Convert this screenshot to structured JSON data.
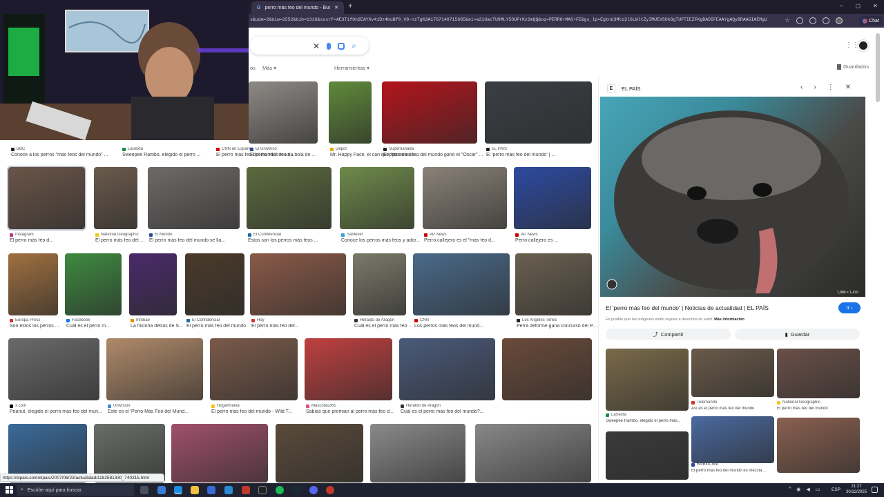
{
  "browser": {
    "active_tab_title": "perro más feo del mundo - Buscar",
    "new_tab_symbol": "+",
    "url": "s&udm=2&biw=2552&bih=1316&sxsrf=AE3TifOn2EAYXv41Dz4buBf0_V8-nzTg%3A1767140715605&ei=a21UacTU9MLY5OUPrKz2mQQ&oq=PERRO+MAS+FE&gs_lp=Egtnd3Mtd2l6LWltZyIMUEVSUk8gTUFTIEZFKgBADIFEAAYgAQyBRAAGIAEMgU",
    "chat_label": "Chat"
  },
  "search": {
    "filter_cut": "os",
    "more_label": "Más",
    "tools_label": "Herramientas",
    "saved_label": "Guardados"
  },
  "results": [
    {
      "source": "BBC",
      "title": "Conoce a los perros \"más feos del mundo\" ...",
      "color": "#8a7a6a",
      "fav": "#222"
    },
    {
      "source": "LaSexta",
      "title": "Sweepee Rambo, elegido el perro ...",
      "color": "#7a6b5c",
      "fav": "#1a8a3a"
    },
    {
      "source": "CNN en Español",
      "title": "El perro más feo del mundo\" es una bola de ...",
      "color": "#b0a79a",
      "fav": "#cc0000"
    },
    {
      "source": "El Universo",
      "title": "El perro 'más feo d...",
      "color": "#8e8a86",
      "fav": "#2a4b8d"
    },
    {
      "source": "Depor",
      "title": "Mr. Happy Face, el can que \"parece un ...",
      "color": "#5f8a3a",
      "fav": "#e6a800"
    },
    {
      "source": "Supernanada",
      "title": "El perro más feo del mundo ganó el \"Óscar\" ...",
      "color": "#b3141c",
      "fav": "#222"
    },
    {
      "source": "EL PAÍS",
      "title": "El 'perro más feo del mundo' | ...",
      "color": "#3a3f44",
      "fav": "#222"
    },
    {
      "source": "Instagram",
      "title": "El perro más feo d...",
      "color": "#6a5548",
      "fav": "#c13584"
    },
    {
      "source": "National Geographic",
      "title": "El perro más feo del mundo",
      "color": "#6b5a4c",
      "fav": "#f5c518"
    },
    {
      "source": "El Mundo",
      "title": "El perro más feo del mundo se lla...",
      "color": "#6e6a68",
      "fav": "#2a4b8d"
    },
    {
      "source": "El Confidencial",
      "title": "Estos son los perros más feos ...",
      "color": "#5c6a3e",
      "fav": "#1a6aa8"
    },
    {
      "source": "Sanlevel",
      "title": "Conoce los perros más feos y ador...",
      "color": "#6e8a4a",
      "fav": "#3aa1d8"
    },
    {
      "source": "AP News",
      "title": "Perro callejero es el \"más feo d...",
      "color": "#8a8278",
      "fav": "#cc0000"
    },
    {
      "source": "AP News",
      "title": "Perro callejero es ...",
      "color": "#2d4aa0",
      "fav": "#cc0000"
    },
    {
      "source": "Europa Press",
      "title": "Son estos los perros ...",
      "color": "#a07040",
      "fav": "#d0342c"
    },
    {
      "source": "Facebook",
      "title": "Cuál es el perro m...",
      "color": "#3e8a40",
      "fav": "#1877f2"
    },
    {
      "source": "Infobae",
      "title": "La historia detrás de S...",
      "color": "#4a2a6a",
      "fav": "#f08a00"
    },
    {
      "source": "El Confidencial",
      "title": "El perro más feo del mundo",
      "color": "#4a3a2a",
      "fav": "#1a6aa8"
    },
    {
      "source": "Hoy",
      "title": "El perro más feo del...",
      "color": "#8a5a48",
      "fav": "#d0342c"
    },
    {
      "source": "Heraldo de Aragón",
      "title": "Cuál es el perro más feo del mundo? | ...",
      "color": "#7a7a6a",
      "fav": "#333"
    },
    {
      "source": "CNN",
      "title": "Los perros más feos del mund...",
      "color": "#4a6a8a",
      "fav": "#cc0000"
    },
    {
      "source": "Los Angeles Times",
      "title": "Perra deforme gana concurso del Per...",
      "color": "#6a6050",
      "fav": "#222"
    },
    {
      "source": "x.com",
      "title": "Peanut, elegido el perro más feo del mun...",
      "color": "#6a6a6a",
      "fav": "#000"
    },
    {
      "source": "Univision",
      "title": "Este es el 'Perro Más Feo del Mund...",
      "color": "#b08a6a",
      "fav": "#3a8ad8"
    },
    {
      "source": "Hogarmania",
      "title": "El perro más feo del mundo - Wild T...",
      "color": "#7a5a4a",
      "fav": "#f5c518"
    },
    {
      "source": "Mascotas365",
      "title": "Sabías que premian al perro más feo d...",
      "color": "#c04040",
      "fav": "#e05080"
    },
    {
      "source": "Heraldo de Aragón",
      "title": "Cuál es el perro más feo del mundo?...",
      "color": "#4a5a7a",
      "fav": "#333"
    },
    {
      "source": "",
      "title": "",
      "color": "#6a4a3a",
      "fav": "#ccc"
    },
    {
      "source": "",
      "title": "",
      "color": "#3a6a9a",
      "fav": "#ccc"
    },
    {
      "source": "",
      "title": "",
      "color": "#6a6e6a",
      "fav": "#ccc"
    },
    {
      "source": "",
      "title": "",
      "color": "#a0506a",
      "fav": "#ccc"
    },
    {
      "source": "",
      "title": "",
      "color": "#5a4a3a",
      "fav": "#ccc"
    },
    {
      "source": "",
      "title": "",
      "color": "#8a8a8a",
      "fav": "#ccc"
    }
  ],
  "panel": {
    "source": "EL PAÍS",
    "image_size": "1,980 × 1,470",
    "title": "El 'perro más feo del mundo' | Noticias de actualidad | EL PAÍS",
    "go_label": "Ir",
    "copyright": "Es posible que las imágenes estén sujetas a derechos de autor.",
    "more_info": "Más información",
    "share_label": "Compartir",
    "save_label": "Guardar",
    "related": [
      {
        "source": "LaSexta",
        "title": "Sweepee Rambo, elegido el perro más...",
        "color": "#7a6a4a",
        "fav": "#1a8a3a"
      },
      {
        "source": "Telemundo",
        "title": "Así es el perro más feo del mundo",
        "color": "#6a5a4a",
        "fav": "#d0342c"
      },
      {
        "source": "National Geographic",
        "title": "El perro más feo del mundo",
        "color": "#6a5048",
        "fav": "#f5c518"
      },
      {
        "source": "",
        "title": "",
        "color": "#3a3a3a",
        "fav": "#ccc"
      },
      {
        "source": "BioBioChile",
        "title": "El perro más feo del mundo es mezcla ...",
        "color": "#4a6aa0",
        "fav": "#2a4b8d"
      },
      {
        "source": "",
        "title": "",
        "color": "#8a6050",
        "fav": "#ccc"
      }
    ]
  },
  "statusbar": {
    "url": "https://elpais.com/elpais/2007/06/23/actualidad/1182581330_740215.html"
  },
  "taskbar": {
    "search_placeholder": "Escribe aquí para buscar.",
    "lang": "ESP",
    "time": "21:27",
    "date": "30/12/2025"
  }
}
